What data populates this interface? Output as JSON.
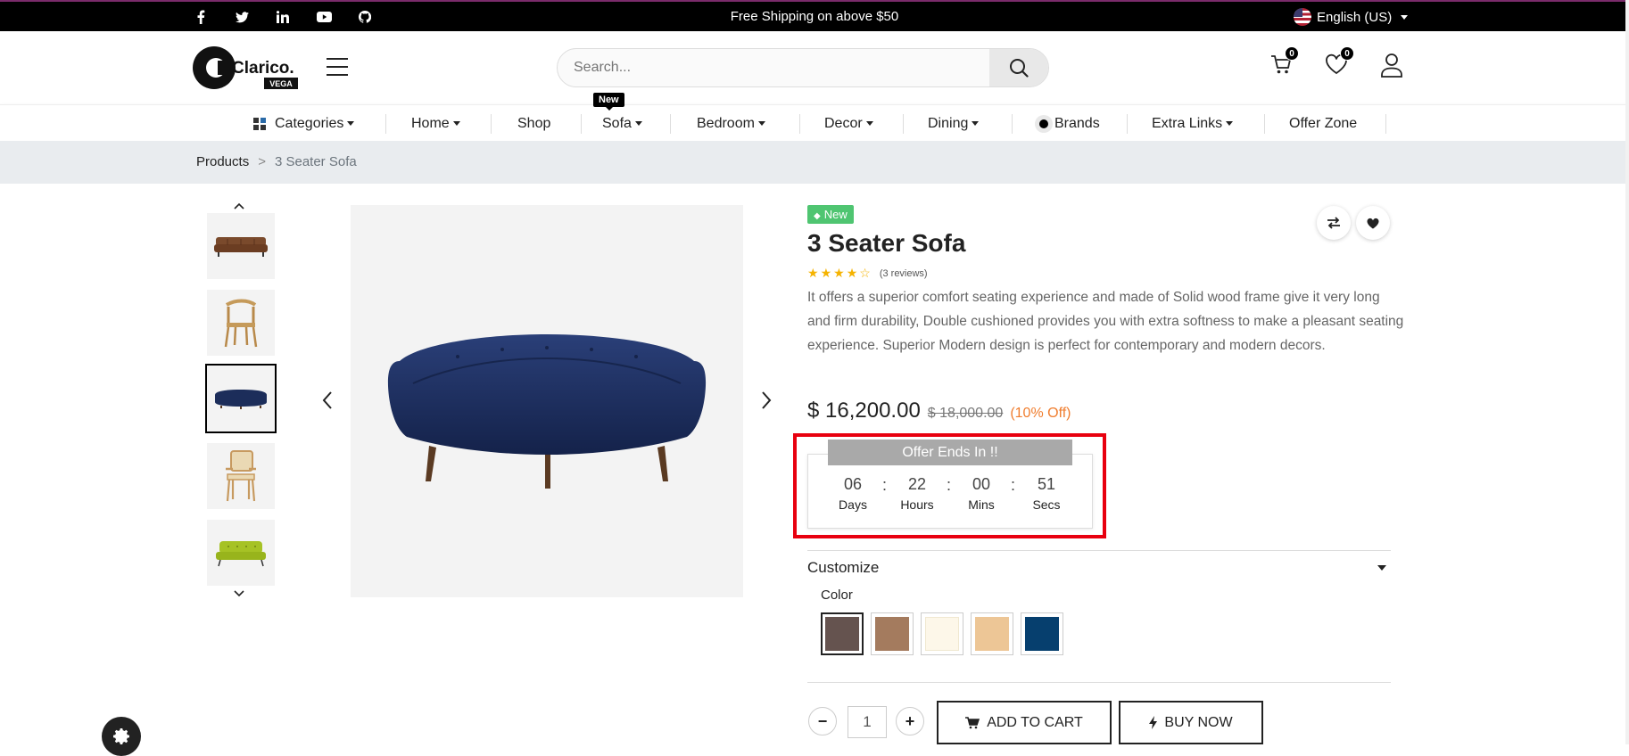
{
  "topbar": {
    "social": [
      "f",
      "t",
      "in",
      "▶",
      "gh"
    ],
    "shipping_text": "Free Shipping on above $50",
    "language": "English (US)"
  },
  "header": {
    "logo_text": "Clarico.",
    "logo_sub": "VEGA",
    "search_placeholder": "Search...",
    "cart_count": "0",
    "wishlist_count": "0"
  },
  "nav": {
    "items": [
      {
        "label": "Categories",
        "dropdown": true
      },
      {
        "label": "Home",
        "dropdown": true
      },
      {
        "label": "Shop",
        "dropdown": false
      },
      {
        "label": "Sofa",
        "dropdown": true
      },
      {
        "label": "Bedroom",
        "dropdown": true
      },
      {
        "label": "Decor",
        "dropdown": true
      },
      {
        "label": "Dining",
        "dropdown": true
      },
      {
        "label": "Brands",
        "dropdown": false
      },
      {
        "label": "Extra Links",
        "dropdown": true
      },
      {
        "label": "Offer Zone",
        "dropdown": false
      }
    ],
    "new_tag": "New"
  },
  "breadcrumb": {
    "parent": "Products",
    "separator": ">",
    "current": "3 Seater Sofa"
  },
  "gallery": {
    "thumbnails": [
      "brown-leather-sofa",
      "wooden-chair",
      "blue-curved-sofa",
      "cane-chair",
      "green-tufted-sofa"
    ],
    "selected_index": 2
  },
  "product": {
    "tag": "New",
    "title": "3 Seater Sofa",
    "rating": 4,
    "reviews": "(3 reviews)",
    "description": "It offers a superior comfort seating experience and made of Solid wood frame give it very long and firm durability, Double cushioned provides you with extra softness to make a pleasant seating experience. Superior Modern design is perfect for contemporary and modern decors.",
    "price": "$ 16,200.00",
    "old_price": "$ 18,000.00",
    "discount": "(10% Off)"
  },
  "offer": {
    "heading": "Offer Ends In !!",
    "days": "06",
    "days_label": "Days",
    "hours": "22",
    "hours_label": "Hours",
    "mins": "00",
    "mins_label": "Mins",
    "secs": "51",
    "secs_label": "Secs",
    "colon": ":"
  },
  "customize": {
    "label": "Customize",
    "color_label": "Color",
    "colors": [
      "#65534f",
      "#a47b5e",
      "#fdf7e9",
      "#edc696",
      "#063f6e"
    ],
    "selected_color_index": 0
  },
  "purchase": {
    "quantity": "1",
    "minus": "−",
    "plus": "+",
    "add_to_cart": "ADD TO CART",
    "buy_now": "BUY NOW"
  }
}
